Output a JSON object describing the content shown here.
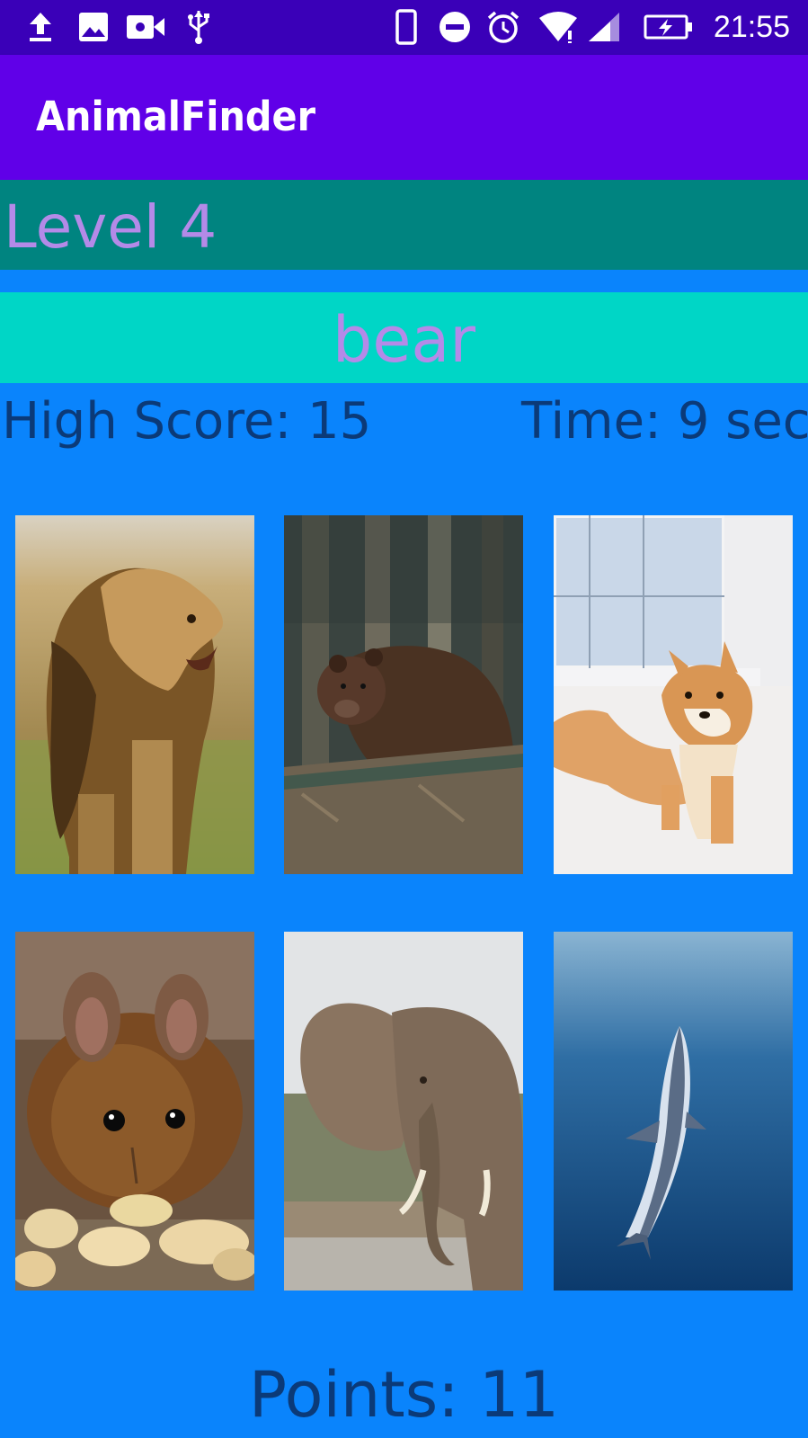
{
  "status_bar": {
    "time": "21:55",
    "icons": [
      "upload-icon",
      "image-icon",
      "video-icon",
      "usb-icon",
      "phone-icon",
      "dnd-icon",
      "alarm-icon",
      "wifi-icon",
      "signal-icon",
      "battery-charging-icon"
    ]
  },
  "app": {
    "title": "AnimalFinder"
  },
  "game": {
    "level_label": "Level 4",
    "target_animal": "bear",
    "high_score": "High Score: 15",
    "time": "Time: 9 sec",
    "points": "Points: 11"
  },
  "grid": {
    "tiles": [
      {
        "animal": "lion"
      },
      {
        "animal": "bear"
      },
      {
        "animal": "dog"
      },
      {
        "animal": "mouse"
      },
      {
        "animal": "elephant"
      },
      {
        "animal": "dolphin"
      }
    ]
  },
  "colors": {
    "status_bar": "#3a00b8",
    "app_bar": "#6000e8",
    "level_bar": "#008480",
    "target_bar": "#00d6c6",
    "background": "#0a84fc",
    "accent_text": "#b48ae8",
    "dark_text": "#0b3a78"
  }
}
